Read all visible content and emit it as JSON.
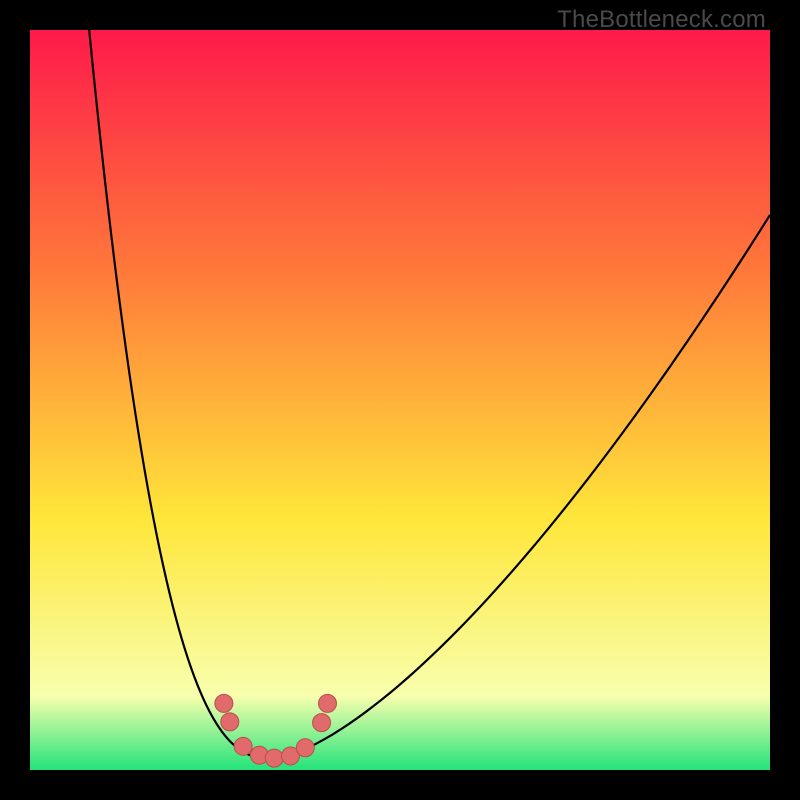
{
  "watermark": "TheBottleneck.com",
  "colors": {
    "grad_top": "#fe1a4a",
    "grad_mid1": "#ff7a3a",
    "grad_mid2": "#ffe63a",
    "grad_low": "#f8ffad",
    "grad_bottom": "#23e37a",
    "curve": "#000000",
    "dot_fill": "#e16a6a",
    "dot_stroke": "#b94e4e",
    "frame": "#000000"
  },
  "chart_data": {
    "type": "line",
    "title": "",
    "xlabel": "",
    "ylabel": "",
    "xlim": [
      0,
      100
    ],
    "ylim": [
      0,
      100
    ],
    "series": [
      {
        "name": "bottleneck-curve",
        "x_min_at": 33,
        "left": {
          "x_start": 8,
          "y_start": 100
        },
        "right": {
          "x_end": 100,
          "y_end": 75
        },
        "floor_y": 1.5
      }
    ],
    "dots": [
      {
        "x": 26.2,
        "y": 9.0
      },
      {
        "x": 27.0,
        "y": 6.5
      },
      {
        "x": 28.8,
        "y": 3.2
      },
      {
        "x": 31.0,
        "y": 2.0
      },
      {
        "x": 33.0,
        "y": 1.6
      },
      {
        "x": 35.2,
        "y": 1.9
      },
      {
        "x": 37.2,
        "y": 3.0
      },
      {
        "x": 39.4,
        "y": 6.4
      },
      {
        "x": 40.2,
        "y": 9.0
      }
    ]
  }
}
